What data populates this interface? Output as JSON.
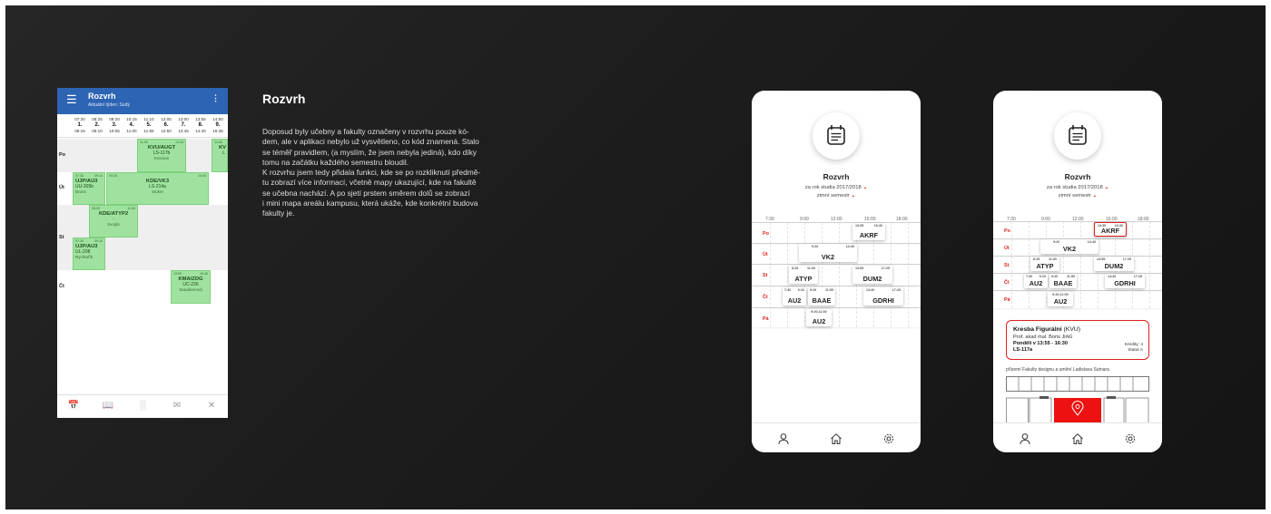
{
  "section": {
    "heading": "Rozvrh",
    "paragraph_lines": [
      "Doposud byly učebny a fakulty označeny v rozvrhu pouze kó-",
      "dem, ale v aplikaci nebylo už vysvětleno, co kód znamená. Stalo",
      "se téměř pravidlem,  (a myslím, že jsem nebyla jediná), kdo díky",
      "tomu na začátku každého semestru bloudil.",
      "K rozvrhu jsem tedy přidala funkci, kde se po rozkliknutí předmě-",
      "tu zobrazí více informací, včetně mapy ukazující, kde na fakultě",
      "se učebna nachází. A po sjetí prstem směrem dolů se zobrazí",
      "i mini mapa areálu kampusu, která ukáže, kde konkrétní budova",
      "fakulty je."
    ]
  },
  "old_app": {
    "title": "Rozvrh",
    "subtitle": "Aktuální týden: Sudý",
    "menu_icon": "hamburger-icon",
    "more_icon": "kebab-icon",
    "slots": [
      {
        "n": "1.",
        "start": "07:30",
        "end": "08:15"
      },
      {
        "n": "2.",
        "start": "08:25",
        "end": "09:10"
      },
      {
        "n": "3.",
        "start": "09:20",
        "end": "10:05"
      },
      {
        "n": "4.",
        "start": "10:15",
        "end": "11:00"
      },
      {
        "n": "5.",
        "start": "11:10",
        "end": "11:55"
      },
      {
        "n": "6.",
        "start": "12:05",
        "end": "12:50"
      },
      {
        "n": "7.",
        "start": "13:00",
        "end": "13:45"
      },
      {
        "n": "8.",
        "start": "13:55",
        "end": "14:40"
      },
      {
        "n": "9.",
        "start": "14:50",
        "end": "15:35"
      }
    ],
    "days": [
      "Po",
      "Út",
      "St",
      "Čt"
    ],
    "lessons": {
      "po_kvu": {
        "code": "KVU/AUGT",
        "room": "LS-117b",
        "who": "Kosman",
        "t1": "11:30",
        "t2": "13:40"
      },
      "po_kv": {
        "code": "KV",
        "room": "L",
        "t1": "14:50"
      },
      "ut_ujp": {
        "code": "UJP/AU3",
        "room": "UU-305b",
        "who": "Brons",
        "t1": "07:30",
        "t2": "09:14"
      },
      "ut_kde": {
        "code": "KDE/VK3",
        "room": "LS-214a",
        "who": "Stoker",
        "t1": "09:20",
        "t2": "14:40"
      },
      "st_kde": {
        "code": "KDE/ATYP2",
        "room": "-",
        "who": "Svojdo",
        "t1": "08:25",
        "t2": "11:50"
      },
      "st_ujp": {
        "code": "UJP/AU3",
        "room": "UL-208",
        "who": "Rychtařík",
        "t1": "07:30",
        "t2": "09:15"
      },
      "ct_kma": {
        "code": "KMA/ZDG",
        "room": "UC-236",
        "who": "Staudeerová",
        "t1": "13:55",
        "t2": "16:30"
      }
    },
    "nav_icons": [
      "calendar-icon",
      "book-icon",
      "chart-icon",
      "mail-icon",
      "tools-icon"
    ]
  },
  "new_app_common": {
    "title": "Rozvrh",
    "year_label": "za rok studia 2017/2018",
    "semester_label": "zimní semestr",
    "hours": [
      "7:30",
      "9:00",
      "12:00",
      "15:00",
      "18:00"
    ],
    "days": [
      "Po",
      "Út",
      "St",
      "Čt",
      "Pá"
    ],
    "tab_icons": [
      "profile-icon",
      "home-icon",
      "settings-icon"
    ]
  },
  "phone1": {
    "cards": {
      "po_akrf": {
        "code": "AKRF",
        "t1": "13:55",
        "t2": "16:30"
      },
      "ut_vk2": {
        "code": "VK2",
        "t1": "9:20",
        "t2": "14:40"
      },
      "st_atyp": {
        "code": "ATYP",
        "t1": "8:25",
        "t2": "11:00"
      },
      "st_dum2": {
        "code": "DUM2",
        "t1": "13:55",
        "t2": "17:25"
      },
      "ct_au2": {
        "code": "AU2",
        "t1": "7:30",
        "t2": "9:10"
      },
      "ct_baae": {
        "code": "BAAE",
        "t1": "9:20",
        "t2": "11:55"
      },
      "ct_gdrhi": {
        "code": "GDRHI",
        "t1": "14:40",
        "t2": "17:25"
      },
      "pa_au2": {
        "code": "AU2",
        "t1": "9:20-11:00"
      }
    }
  },
  "phone2": {
    "cards": {
      "po_akrf": {
        "code": "AKRF",
        "t1": "13:55",
        "t2": "16:30"
      },
      "ut_vk2": {
        "code": "VK2",
        "t1": "9:20",
        "t2": "14:40"
      },
      "st_atyp": {
        "code": "ATYP",
        "t1": "8:25",
        "t2": "11:00"
      },
      "st_dum2": {
        "code": "DUM2",
        "t1": "13:55",
        "t2": "17:25"
      },
      "ct_au2": {
        "code": "AU2",
        "t1": "7:30",
        "t2": "9:10"
      },
      "ct_baae": {
        "code": "BAAE",
        "t1": "9:20",
        "t2": "11:55"
      },
      "ct_gdrhi": {
        "code": "GDRHI",
        "t1": "14:40",
        "t2": "17:25"
      },
      "pa_au2": {
        "code": "AU2",
        "t1": "9:20-11:00"
      }
    },
    "detail": {
      "name": "Kresba Figurální",
      "abbr": "(KVU)",
      "teacher": "Prof. akad mal. Boris Jirků",
      "when": "Pondělí v 13:55 - 16:30",
      "room": "LS-117a",
      "credits": "Kredity: 4",
      "status": "Statut A"
    },
    "map_caption": "přízemí Fakulty designu a umění Ladislava Sutnara",
    "map_pin_icon": "location-pin-icon",
    "accent": "#e02020"
  },
  "colors": {
    "old_app_bar": "#2d64b3",
    "lesson_green": "#9fe29f",
    "accent_red": "#e02020",
    "background": "#1e1e1e"
  }
}
